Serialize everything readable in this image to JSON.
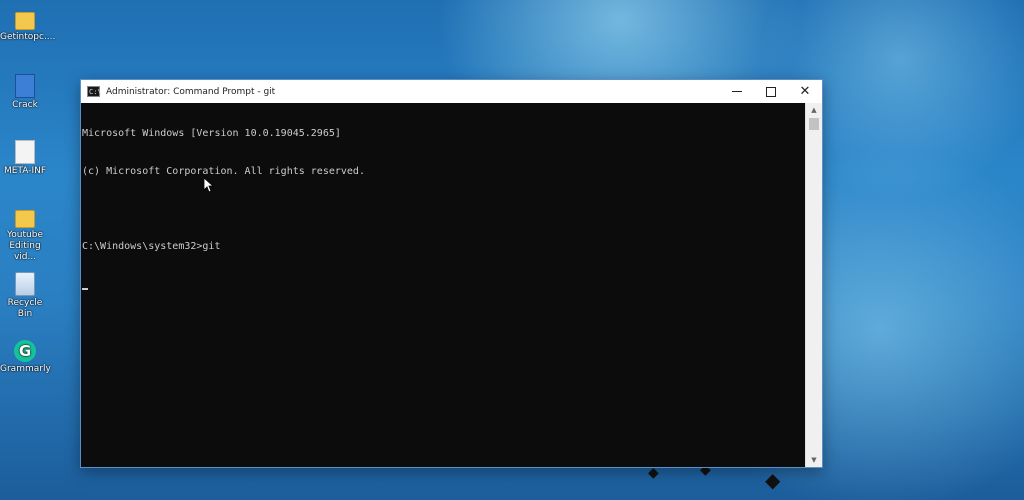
{
  "desktop": {
    "icons": [
      {
        "label": "Getintopc....",
        "icon": "folder-icon"
      },
      {
        "label": "Crack",
        "icon": "exe-icon"
      },
      {
        "label": "META-INF",
        "icon": "file-icon"
      },
      {
        "label": "Youtube Editing vid...",
        "icon": "folder-icon"
      },
      {
        "label": "Recycle Bin",
        "icon": "recycle-bin-icon"
      },
      {
        "label": "Grammarly",
        "icon": "grammarly-icon"
      }
    ]
  },
  "window": {
    "title": "Administrator: Command Prompt - git",
    "controls": {
      "minimize": "minimize",
      "maximize": "maximize",
      "close": "close"
    }
  },
  "console": {
    "lines": [
      "Microsoft Windows [Version 10.0.19045.2965]",
      "(c) Microsoft Corporation. All rights reserved.",
      "",
      "C:\\Windows\\system32>git"
    ]
  }
}
